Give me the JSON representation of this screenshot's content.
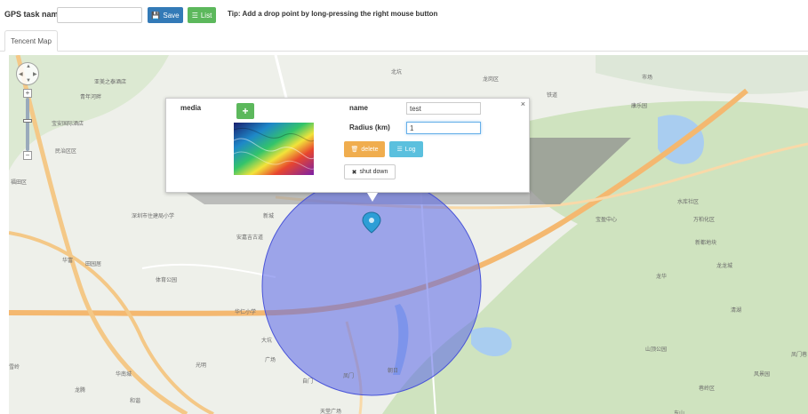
{
  "toolbar": {
    "task_label": "GPS task name",
    "task_value": "",
    "save_label": "Save",
    "list_label": "List",
    "tip": "Tip: Add a drop point by long-pressing the right mouse button"
  },
  "tabs": [
    {
      "label": "Tencent Map"
    }
  ],
  "map": {
    "labels": [
      "亚美之泰酒店",
      "青年河畔",
      "宝安国际酒店",
      "民治区区",
      "福田区",
      "深圳市住建局小学",
      "田园居",
      "体育公园",
      "安嘉吉古道",
      "新城",
      "北坑",
      "龙岗区",
      "铁道",
      "康乐园",
      "市场",
      "宝盈中心",
      "万柏化区",
      "水库社区",
      "新都地块",
      "龙龙城",
      "龙华",
      "清湖",
      "山顶公园",
      "风景园",
      "巷岭区",
      "凤门巷",
      "华富",
      "雪岭",
      "龙腾",
      "华南城",
      "和谐",
      "光明",
      "广场",
      "华仁小学",
      "大坑",
      "自门",
      "凤门",
      "朝日",
      "天堂广场",
      "东山"
    ],
    "circle_color": "#5a66e8",
    "marker_color": "#2e9ed6"
  },
  "panel": {
    "media_label": "media",
    "add_label": "+",
    "name_label": "name",
    "name_value": "test",
    "radius_label": "Radius (km)",
    "radius_value": "1",
    "delete_label": "delete",
    "log_label": "Log",
    "shutdown_label": "shut down",
    "close_label": "×"
  }
}
